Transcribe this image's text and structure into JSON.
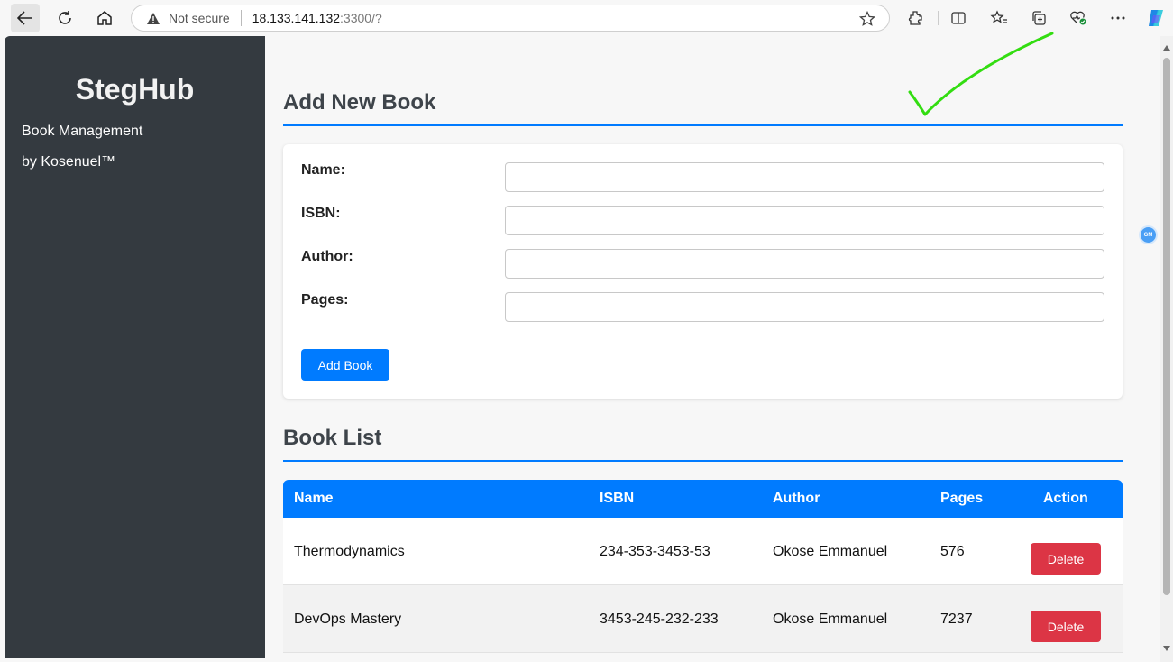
{
  "browser": {
    "not_secure": "Not secure",
    "url_host": "18.133.141.132",
    "url_rest": ":3300/?"
  },
  "sidebar": {
    "brand": "StegHub",
    "line1": "Book Management",
    "line2": "by Kosenuel™"
  },
  "add_section": {
    "title": "Add New Book",
    "labels": {
      "name": "Name:",
      "isbn": "ISBN:",
      "author": "Author:",
      "pages": "Pages:"
    },
    "values": {
      "name": "",
      "isbn": "",
      "author": "",
      "pages": ""
    },
    "button": "Add Book"
  },
  "list_section": {
    "title": "Book List",
    "headers": {
      "name": "Name",
      "isbn": "ISBN",
      "author": "Author",
      "pages": "Pages",
      "action": "Action"
    },
    "rows": [
      {
        "name": "Thermodynamics",
        "isbn": "234-353-3453-53",
        "author": "Okose Emmanuel",
        "pages": "576",
        "action": "Delete"
      },
      {
        "name": "DevOps Mastery",
        "isbn": "3453-245-232-233",
        "author": "Okose Emmanuel",
        "pages": "7237",
        "action": "Delete"
      }
    ]
  },
  "badge": "GM",
  "colors": {
    "accent": "#007bff",
    "sidebar": "#343a40",
    "danger": "#dc3545",
    "annotation": "#33dd11"
  }
}
